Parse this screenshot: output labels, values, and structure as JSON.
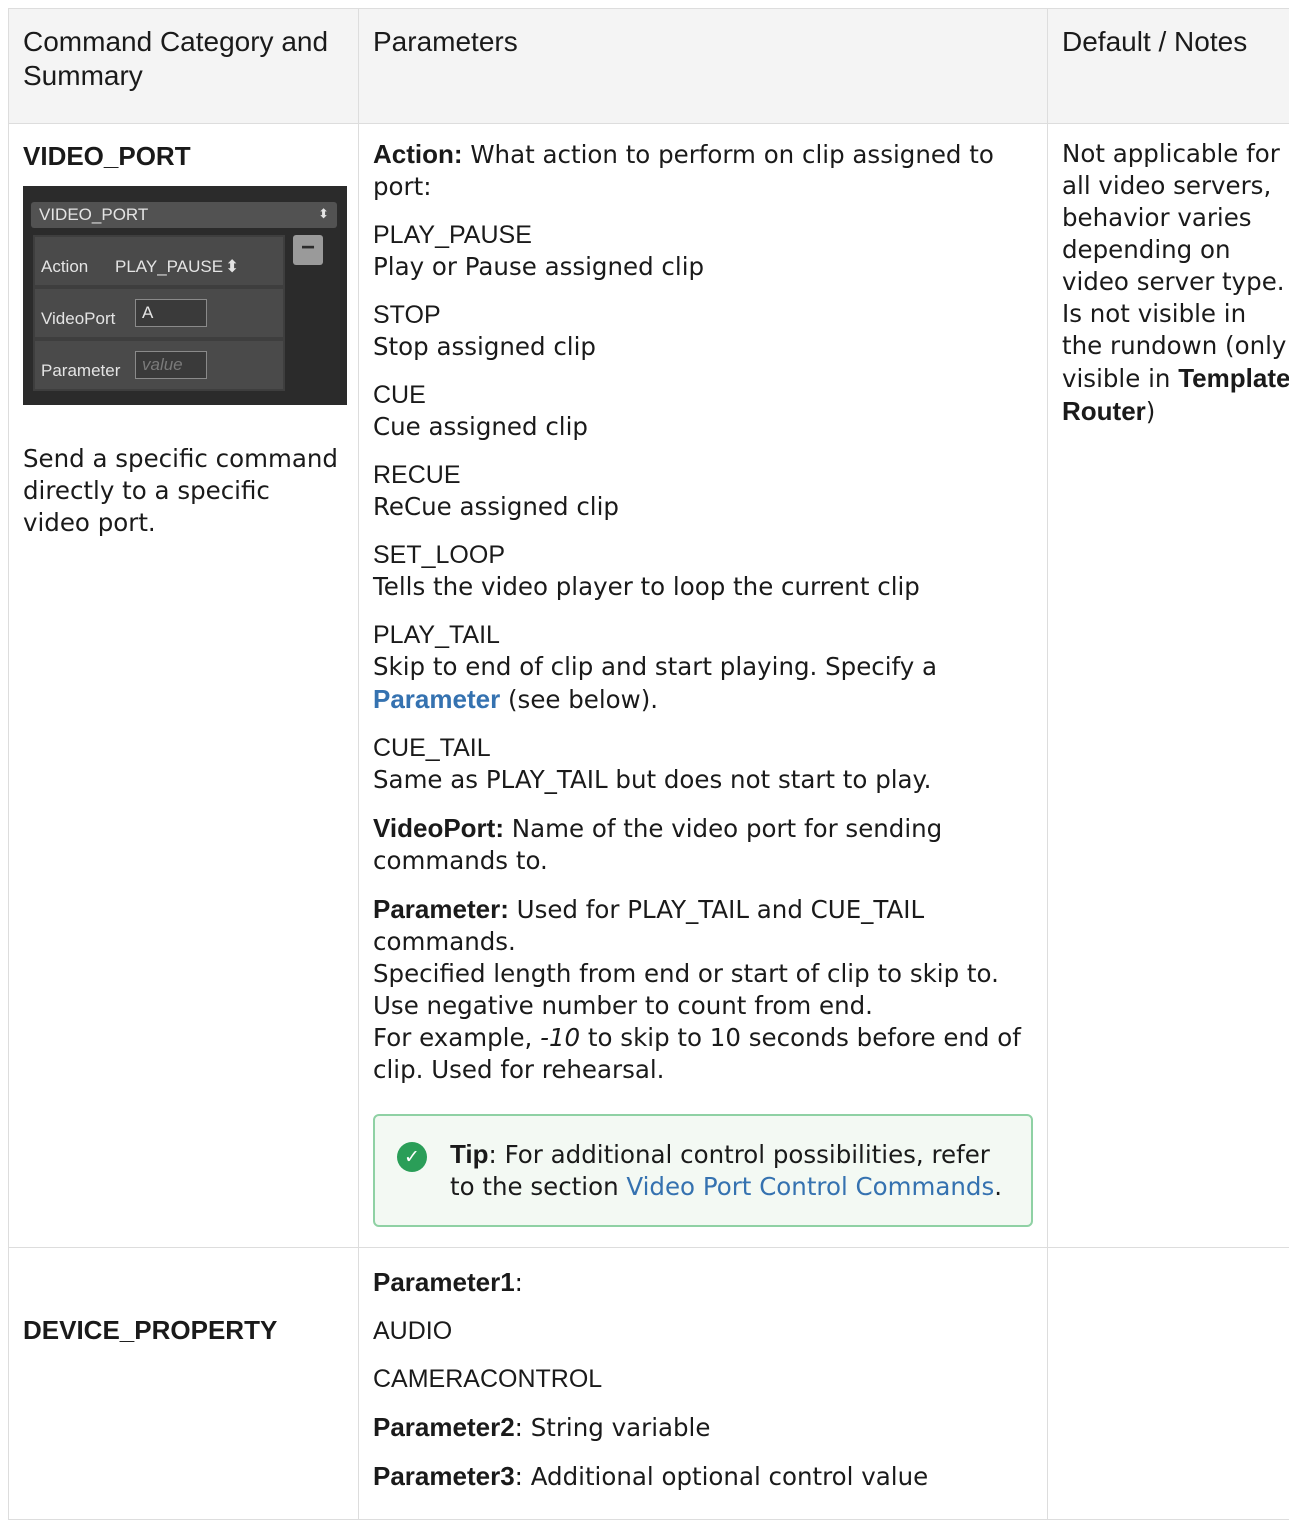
{
  "table": {
    "headers": [
      "Command Category and Summary",
      "Parameters",
      "Default / Notes"
    ],
    "row1": {
      "category": "VIDEO_PORT",
      "widget": {
        "title": "VIDEO_PORT",
        "action_label": "Action",
        "action_value": "PLAY_PAUSE",
        "videoport_label": "VideoPort",
        "videoport_value": "A",
        "parameter_label": "Parameter",
        "parameter_placeholder": "value"
      },
      "summary": "Send a specific command directly to a specific video port.",
      "action_label": "Action:",
      "action_desc": " What action to perform on clip assigned to port:",
      "actions": [
        {
          "name": "PLAY_PAUSE",
          "desc": "Play or Pause assigned clip"
        },
        {
          "name": "STOP",
          "desc": "Stop assigned clip"
        },
        {
          "name": "CUE",
          "desc": "Cue assigned clip"
        },
        {
          "name": "RECUE",
          "desc": "ReCue assigned clip"
        },
        {
          "name": "SET_LOOP",
          "desc": "Tells the video player to loop the current clip"
        }
      ],
      "play_tail": {
        "name": "PLAY_TAIL",
        "desc": "Skip to end of clip and start playing. Specify a ",
        "link": "Parameter",
        "desc_end": " (see below)."
      },
      "cue_tail": {
        "name": "CUE_TAIL",
        "desc": "Same as PLAY_TAIL but does not start to play."
      },
      "videoport": {
        "label": "VideoPort:",
        "desc": " Name of the video port for sending commands to."
      },
      "parameter": {
        "label": "Parameter:",
        "desc1": " Used for PLAY_TAIL and CUE_TAIL commands.",
        "desc2": "Specified length from end or start of clip to skip to. Use negative number to count from end.",
        "desc3_pre": "For example, ",
        "desc3_val": "-10",
        "desc3_post": " to skip to 10 seconds before end of clip. Used for rehearsal."
      },
      "tip": {
        "label": "Tip",
        "text": ": For additional control possibilities, refer to the section ",
        "link": "Video Port Control Commands",
        "end": "."
      },
      "notes_1": "Not applicable for all video servers, behavior varies depending on video server type.",
      "notes_2": "Is not visible in the rundown (only visible in ",
      "notes_bold": "Template Router",
      "notes_end": ")"
    },
    "row2": {
      "category": "DEVICE_PROPERTY",
      "p1_label": "Parameter1",
      "p1_colon": ":",
      "p1_values": [
        "AUDIO",
        "CAMERACONTROL"
      ],
      "p2_label": "Parameter2",
      "p2_desc": ": String variable",
      "p3_label": "Parameter3",
      "p3_desc": ": Additional optional control value"
    }
  }
}
